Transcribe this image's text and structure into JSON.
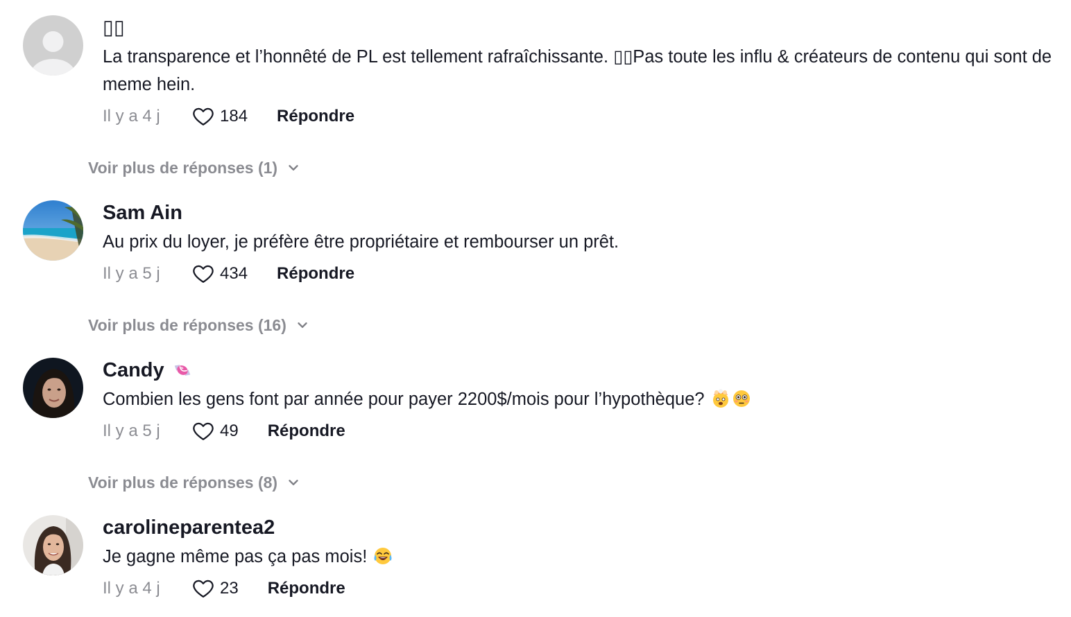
{
  "comments": [
    {
      "username": "",
      "username_glyph": "▯▯",
      "text": "La transparence et l’honnêté de PL est tellement rafraîchissante. ▯▯Pas toute les influ & créateurs de contenu qui sont de meme hein.",
      "time": "Il y a 4 j",
      "likes": "184",
      "reply_label": "Répondre",
      "more_replies": "Voir plus de réponses (1)",
      "avatar": "default-avatar-icon"
    },
    {
      "username": "Sam Ain",
      "text": "Au prix du loyer, je préfère être propriétaire et rembourser un prêt.",
      "time": "Il y a 5 j",
      "likes": "434",
      "reply_label": "Répondre",
      "more_replies": "Voir plus de réponses (16)",
      "avatar": "beach-photo-avatar"
    },
    {
      "username": "Candy",
      "username_emoji": "candy-emoji",
      "text": "Combien les gens font par année pour payer 2200$/mois pour l’hypothèque?",
      "text_emojis": [
        "exploding-head-emoji",
        "flushed-face-emoji"
      ],
      "time": "Il y a 5 j",
      "likes": "49",
      "reply_label": "Répondre",
      "more_replies": "Voir plus de réponses (8)",
      "avatar": "woman-selfie-avatar"
    },
    {
      "username": "carolineparentea2",
      "text": "Je gagne même pas ça pas mois!",
      "text_emojis": [
        "tears-of-joy-emoji"
      ],
      "time": "Il y a 4 j",
      "likes": "23",
      "reply_label": "Répondre",
      "avatar": "woman-portrait-avatar"
    }
  ],
  "colors": {
    "text_primary": "#161823",
    "text_secondary": "rgba(22,24,35,0.5)",
    "background": "#ffffff"
  },
  "icons": {
    "like": "heart-outline-icon",
    "expand": "chevron-down-icon"
  }
}
